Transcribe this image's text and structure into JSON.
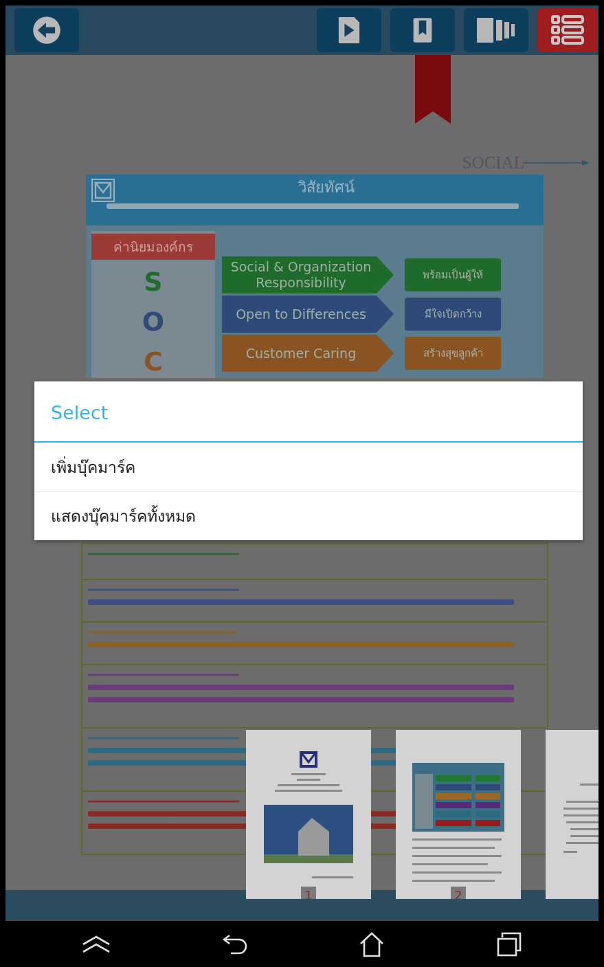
{
  "toolbar": {
    "buttons": [
      {
        "kind": "back",
        "selected": false
      },
      {
        "kind": "play",
        "selected": false
      },
      {
        "kind": "bookmark",
        "selected": false
      },
      {
        "kind": "pages",
        "selected": false
      },
      {
        "kind": "list",
        "selected": true
      }
    ]
  },
  "page": {
    "bookmarked": true,
    "side_label": "SOCIAL",
    "title": "วิสัยทัศน์",
    "values_tag": "ค่านิยมองค์กร",
    "values": [
      {
        "letter": "S",
        "name": "Social & Organization Responsibility",
        "thai": "พร้อมเป็นผู้ให้",
        "color": "#1f6b2c"
      },
      {
        "letter": "O",
        "name": "Open to Differences",
        "thai": "มีใจเปิดกว้าง",
        "color": "#2d4a78"
      },
      {
        "letter": "C",
        "name": "Customer Caring",
        "thai": "สร้างสุขลูกค้า",
        "color": "#8a5422"
      }
    ],
    "definitions": [
      {
        "kind": "short",
        "color": "#2e6a2e"
      },
      {
        "kind": "medium",
        "color": "#3a4f86"
      },
      {
        "kind": "medium",
        "color": "#8a6224"
      },
      {
        "kind": "long",
        "color": "#6a3a7a"
      },
      {
        "kind": "long",
        "color": "#2c6a82"
      },
      {
        "kind": "long",
        "color": "#8a2a22"
      }
    ]
  },
  "dialog": {
    "title": "Select",
    "items": [
      "เพิ่มบุ๊คมาร์ค",
      "แสดงบุ๊คมาร์คทั้งหมด"
    ]
  },
  "thumbnails": [
    {
      "kind": "cover",
      "label": "1"
    },
    {
      "kind": "values",
      "label": "2"
    },
    {
      "kind": "text"
    }
  ],
  "nav_bar": [
    {
      "kind": "up"
    },
    {
      "kind": "back"
    },
    {
      "kind": "home"
    },
    {
      "kind": "recents"
    }
  ]
}
